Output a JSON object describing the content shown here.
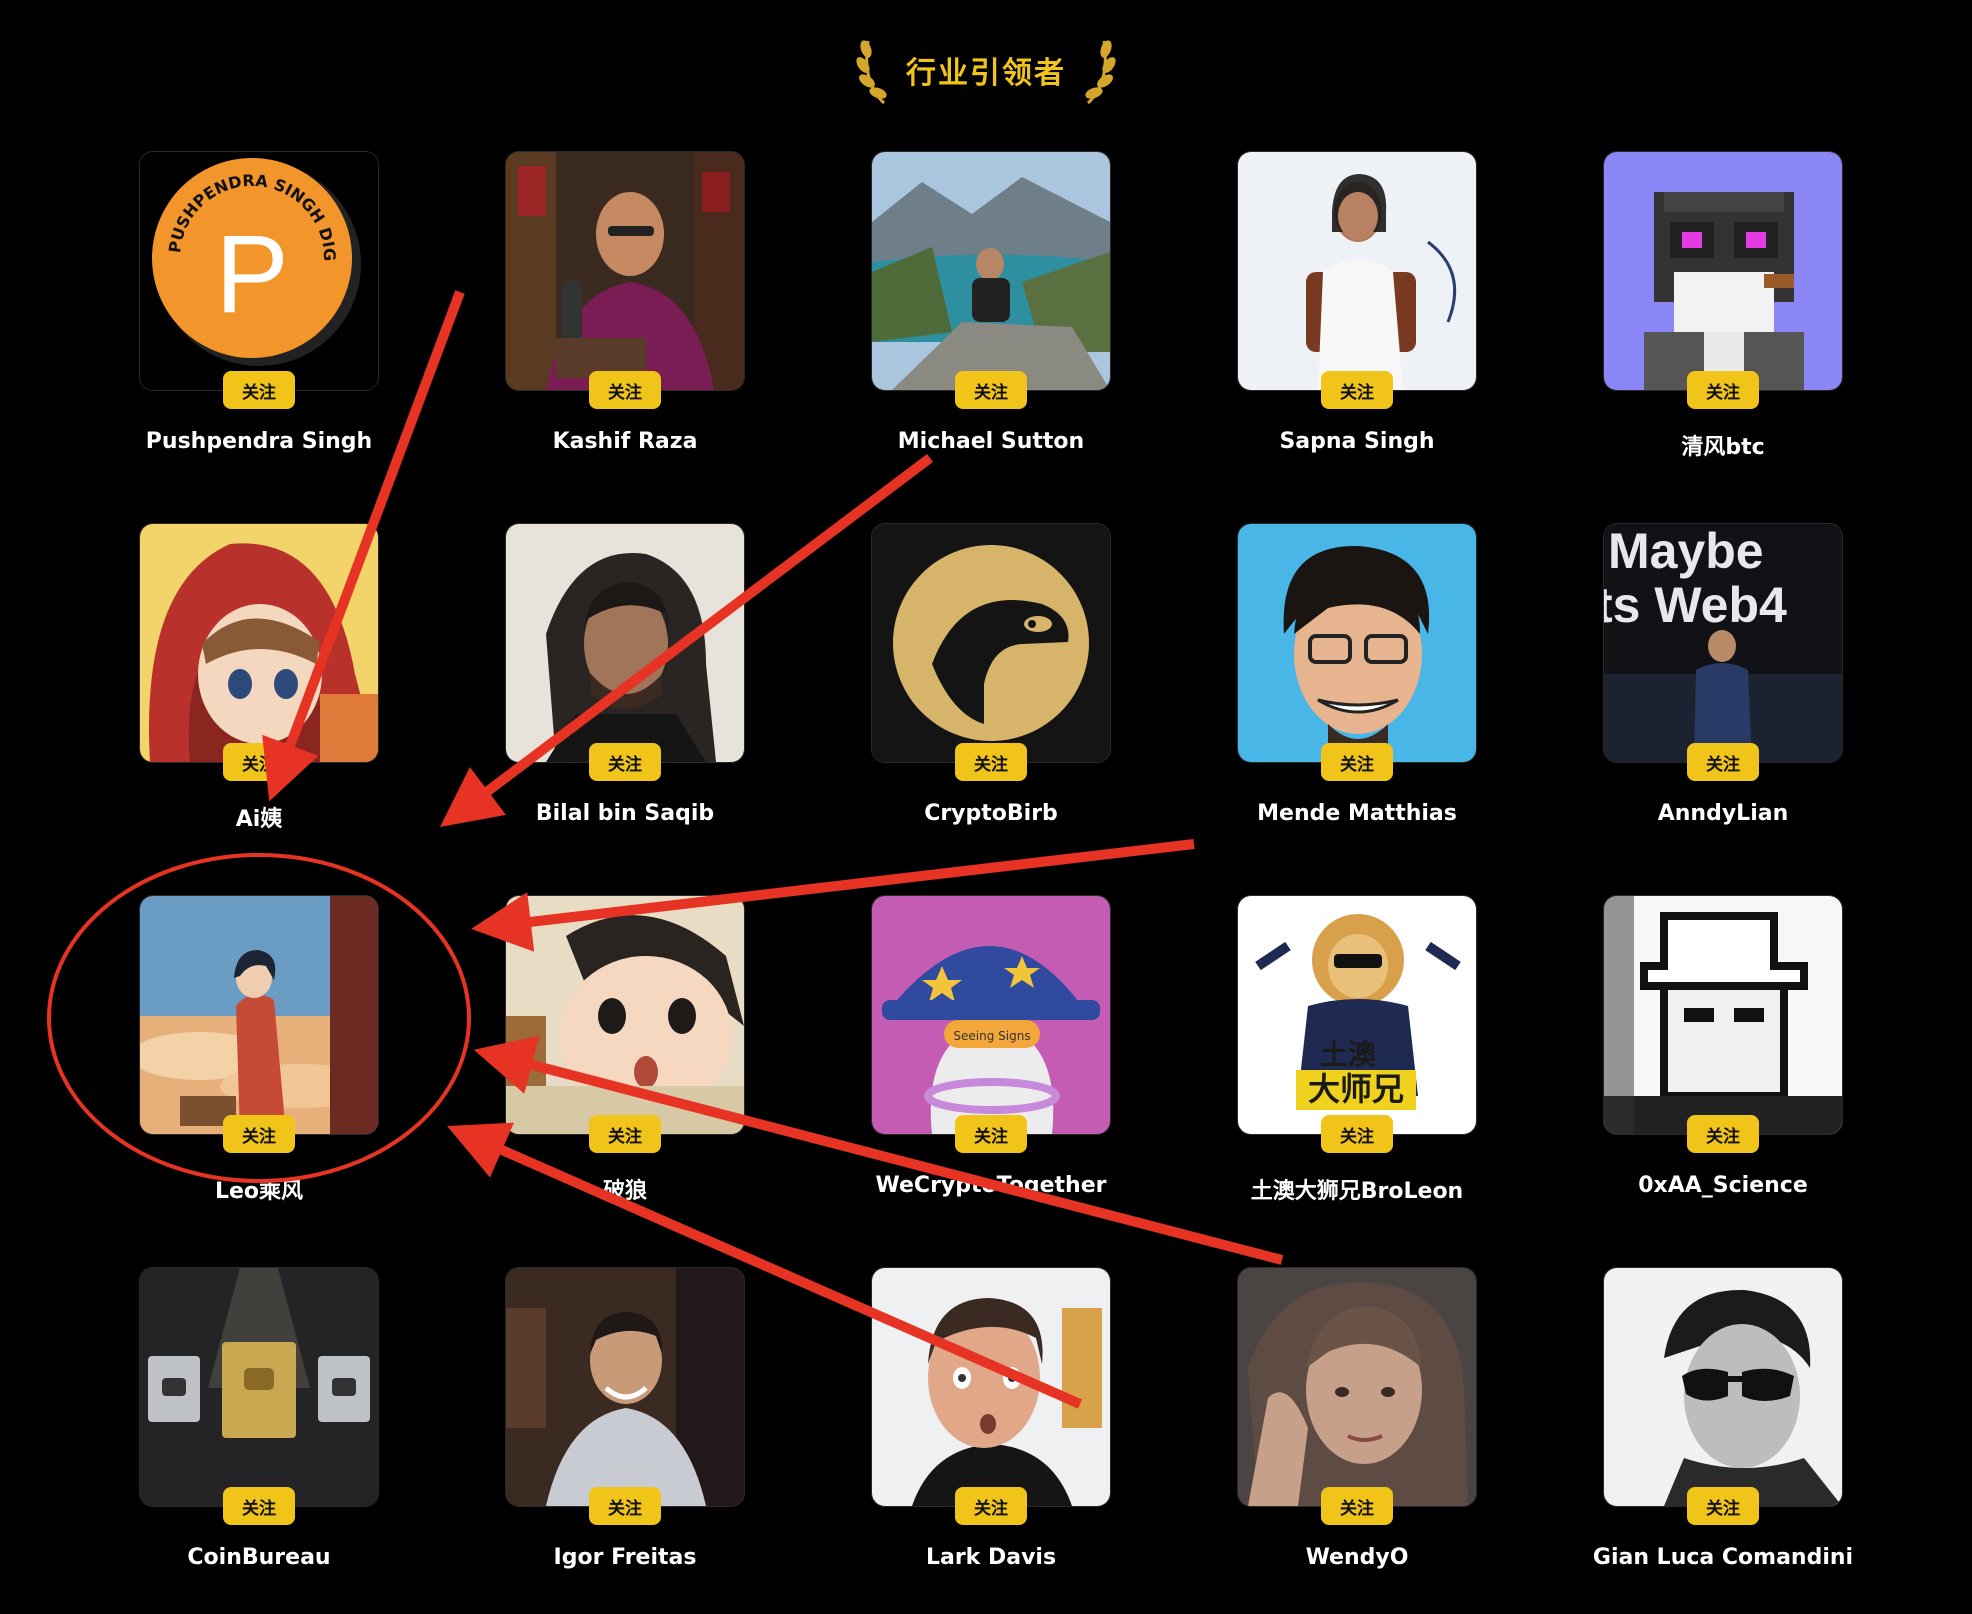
{
  "header": {
    "title": "行业引领者"
  },
  "colors": {
    "accent": "#f0c419",
    "annotation": "#e63323",
    "background": "#000000"
  },
  "follow_label": "关注",
  "leaders": [
    {
      "name": "Pushpendra Singh",
      "avatar_icon": "pushpendra-logo-icon",
      "logo_text": "PUSHPENDRA SINGH DIGITAL",
      "logo_letter": "P"
    },
    {
      "name": "Kashif Raza",
      "avatar_icon": "podcast-host-photo"
    },
    {
      "name": "Michael Sutton",
      "avatar_icon": "mountain-lake-photo"
    },
    {
      "name": "Sapna Singh",
      "avatar_icon": "speaker-chair-photo"
    },
    {
      "name": "清风btc",
      "avatar_icon": "pixel-frog-icon"
    },
    {
      "name": "Ai姨",
      "avatar_icon": "anime-red-hood-icon"
    },
    {
      "name": "Bilal bin Saqib",
      "avatar_icon": "portrait-photo"
    },
    {
      "name": "CryptoBirb",
      "avatar_icon": "bird-logo-icon"
    },
    {
      "name": "Mende Matthias",
      "avatar_icon": "cartoon-glasses-icon"
    },
    {
      "name": "AnndyLian",
      "avatar_icon": "web4-stage-photo",
      "bg_text_1": "Maybe",
      "bg_text_2": "ts Web4"
    },
    {
      "name": "Leo乘风",
      "avatar_icon": "anime-traveler-icon"
    },
    {
      "name": "破狼",
      "avatar_icon": "anime-boy-icon"
    },
    {
      "name": "WeCryptoTogether",
      "avatar_icon": "wizard-penguin-icon",
      "sign_text": "Seeing Signs"
    },
    {
      "name": "土澳大狮兄BroLeon",
      "avatar_icon": "lion-suit-icon",
      "logo_line_1": "土澳",
      "logo_line_2": "大师兄"
    },
    {
      "name": "0xAA_Science",
      "avatar_icon": "pixel-hat-icon"
    },
    {
      "name": "CoinBureau",
      "avatar_icon": "play-buttons-icon"
    },
    {
      "name": "Igor Freitas",
      "avatar_icon": "suit-portrait-photo"
    },
    {
      "name": "Lark Davis",
      "avatar_icon": "surprised-face-photo"
    },
    {
      "name": "WendyO",
      "avatar_icon": "woman-portrait-photo"
    },
    {
      "name": "Gian Luca Comandini",
      "avatar_icon": "sunglasses-portrait-photo"
    }
  ]
}
